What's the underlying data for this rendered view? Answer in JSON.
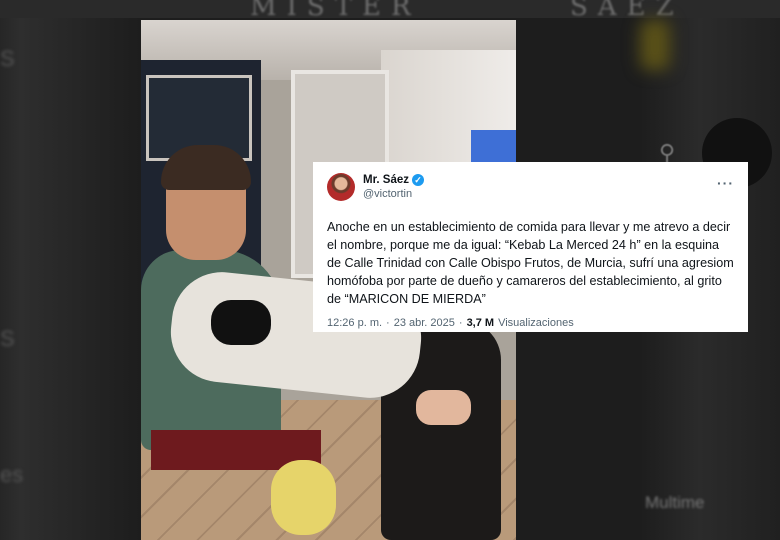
{
  "background": {
    "header_left": "MISTER",
    "header_right": "SAEZ",
    "side_letters": [
      "S",
      "S",
      "es"
    ],
    "search_icon": "search-icon",
    "side_label": "Multime"
  },
  "video": {
    "description_icon": "video-frame"
  },
  "tweet": {
    "display_name": "Mr. Sáez",
    "verified_icon": "verified-badge-icon",
    "handle": "@victortin",
    "more_icon": "more-options-icon",
    "more_symbol": "···",
    "text": "Anoche en un establecimiento de comida para llevar y me atrevo a decir el nombre, porque me da igual: “Kebab La Merced 24 h” en la esquina de Calle Trinidad con Calle Obispo Frutos, de Murcia, sufrí una agresiom homófoba por parte de dueño y camareros del establecimiento, al grito de “MARICON DE MIERDA”",
    "time": "12:26 p. m.",
    "separator": "·",
    "date": "23 abr. 2025",
    "views_count": "3,7 M",
    "views_label": "Visualizaciones"
  },
  "colors": {
    "accent": "#1d9bf0",
    "text": "#0f1419",
    "muted": "#536471"
  }
}
